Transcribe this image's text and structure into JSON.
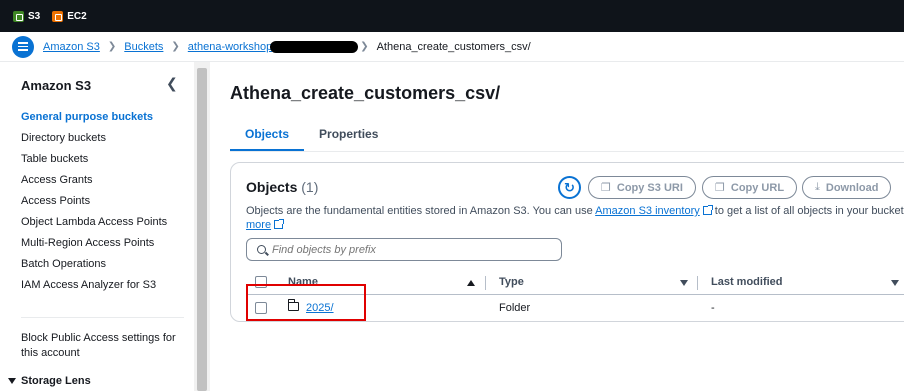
{
  "favorites": [
    {
      "label": "S3",
      "icon": "s3-service-icon",
      "color": "#3f8624"
    },
    {
      "label": "EC2",
      "icon": "ec2-service-icon",
      "color": "#ed7100"
    }
  ],
  "breadcrumb": {
    "items": [
      "Amazon S3",
      "Buckets",
      "athena-workshop"
    ],
    "current": "Athena_create_customers_csv/"
  },
  "sidebar": {
    "title": "Amazon S3",
    "items": [
      "General purpose buckets",
      "Directory buckets",
      "Table buckets",
      "Access Grants",
      "Access Points",
      "Object Lambda Access Points",
      "Multi-Region Access Points",
      "Batch Operations",
      "IAM Access Analyzer for S3"
    ],
    "active_index": 0,
    "block_public_access": "Block Public Access settings for this account",
    "storage_lens": "Storage Lens"
  },
  "page": {
    "title": "Athena_create_customers_csv/",
    "tabs": [
      "Objects",
      "Properties"
    ]
  },
  "objects_card": {
    "title": "Objects",
    "count": "(1)",
    "buttons": {
      "copy_s3_uri": "Copy S3 URI",
      "copy_url": "Copy URL",
      "download": "Download"
    },
    "description_before": "Objects are the fundamental entities stored in Amazon S3. You can use ",
    "description_link": "Amazon S3 inventory",
    "description_after": " to get a list of all objects in your bucket. Fo",
    "more_link": "more",
    "search_placeholder": "Find objects by prefix",
    "columns": [
      "Name",
      "Type",
      "Last modified"
    ],
    "rows": [
      {
        "name": "2025/",
        "type": "Folder",
        "last_modified": "-"
      }
    ]
  },
  "colors": {
    "accent": "#0972d3",
    "topbar": "#0f141a",
    "highlight": "#e00000"
  }
}
